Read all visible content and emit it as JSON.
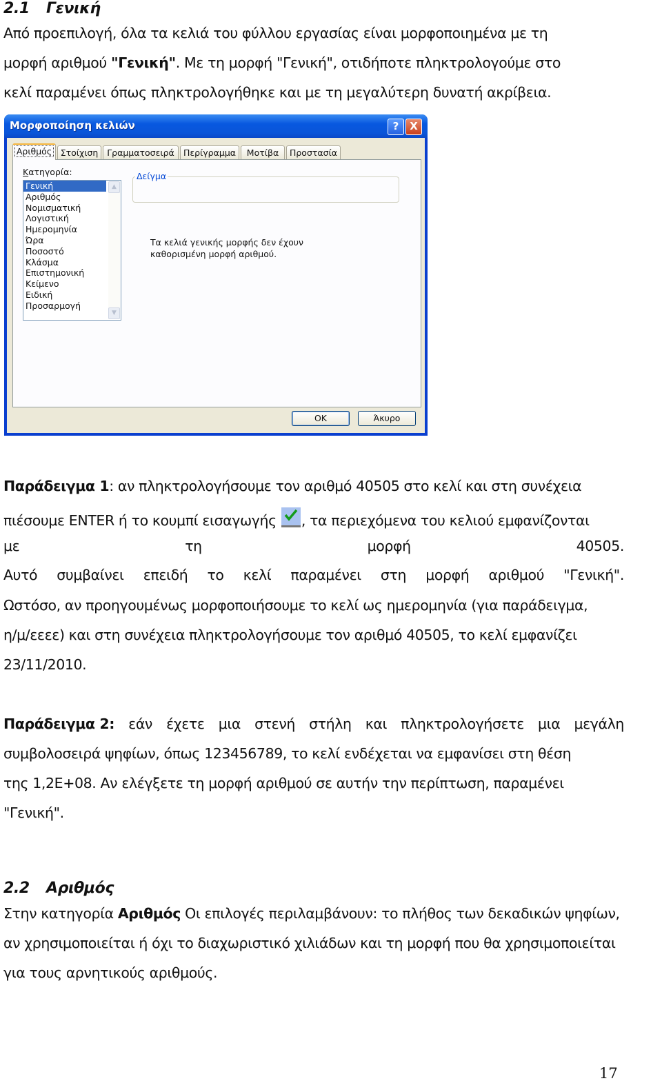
{
  "section_1": {
    "number": "2.1",
    "title": "Γενική",
    "intro_lines": [
      "Από προεπιλογή, όλα τα κελιά του φύλλου εργασίας είναι μορφοποιημένα με τη",
      {
        "pre": "μορφή αριθμού ",
        "bold": "\"Γενική\"",
        "post": ". Με τη μορφή \"Γενική\", οτιδήποτε πληκτρολογούμε στο"
      },
      "κελί παραμένει όπως πληκτρολογήθηκε και με τη μεγαλύτερη δυνατή ακρίβεια."
    ]
  },
  "dialog": {
    "title": "Μορφοποίηση κελιών",
    "help_label": "?",
    "close_label": "X",
    "tabs": [
      {
        "label": "Αριθμός",
        "active": true
      },
      {
        "label": "Στοίχιση",
        "active": false
      },
      {
        "label": "Γραμματοσειρά",
        "active": false
      },
      {
        "label": "Περίγραμμα",
        "active": false
      },
      {
        "label": "Μοτίβα",
        "active": false
      },
      {
        "label": "Προστασία",
        "active": false
      }
    ],
    "category_label_accel": "Κ",
    "category_label_rest": "ατηγορία:",
    "categories": [
      "Γενική",
      "Αριθμός",
      "Νομισματική",
      "Λογιστική",
      "Ημερομηνία",
      "Ώρα",
      "Ποσοστό",
      "Κλάσμα",
      "Επιστημονική",
      "Κείμενο",
      "Ειδική",
      "Προσαρμογή"
    ],
    "selected_category": "Γενική",
    "sample_label": "Δείγμα",
    "sample_value": "",
    "description": "Τα κελιά γενικής μορφής δεν έχουν\nκαθορισμένη μορφή αριθμού.",
    "ok_label": "OK",
    "cancel_label": "Άκυρο",
    "scroll_up": "▲",
    "scroll_down": "▼"
  },
  "example_1": {
    "label": "Παράδειγμα 1",
    "line1": ": αν πληκτρολογήσουμε τον αριθμό 40505 στο κελί και στη συνέχεια",
    "line2_pre": "πιέσουμε ENTER ή το κουμπί εισαγωγής ",
    "line2_post": ", τα περιεχόμενα του κελιού εμφανίζονται",
    "line3_words": [
      "με",
      "τη",
      "μορφή",
      "40505."
    ],
    "line4_words": [
      "Αυτό",
      "συμβαίνει",
      "επειδή",
      "το",
      "κελί",
      "παραμένει",
      "στη",
      "μορφή",
      "αριθμού",
      "\"Γενική\"."
    ],
    "line5": "Ωστόσο, αν προηγουμένως μορφοποιήσουμε το κελί ως ημερομηνία (για παράδειγμα,",
    "line6": "η/μ/εεεε) και στη συνέχεια πληκτρολογήσουμε τον αριθμό 40505, το κελί εμφανίζει",
    "line7": "23/11/2010."
  },
  "example_2": {
    "label": "Παράδειγμα 2:",
    "line1_words": [
      "εάν",
      "έχετε",
      "μια",
      "στενή",
      "στήλη",
      "και",
      "πληκτρολογήσετε",
      "μια",
      "μεγάλη"
    ],
    "line2": "συμβολοσειρά ψηφίων, όπως 123456789, το κελί ενδέχεται να εμφανίσει στη θέση",
    "line3": "της 1,2E+08. Αν ελέγξετε τη μορφή αριθμού σε αυτήν την περίπτωση, παραμένει",
    "line4": "\"Γενική\"."
  },
  "section_2": {
    "number": "2.2",
    "title": "Αριθμός",
    "line1_pre": "Στην κατηγορία ",
    "line1_bold": "Αριθμός",
    "line1_post": " Οι επιλογές περιλαμβάνουν: το πλήθος των δεκαδικών ψηφίων,",
    "line2": "αν χρησιμοποιείται ή όχι το διαχωριστικό χιλιάδων και τη μορφή που θα χρησιμοποιείται",
    "line3": "για τους αρνητικούς αριθμούς."
  },
  "page_number": "17"
}
